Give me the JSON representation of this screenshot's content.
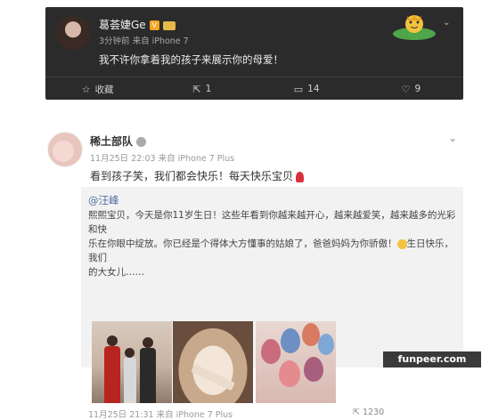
{
  "post1": {
    "user": "葛荟婕Ge",
    "meta": "3分钟前 来自 iPhone 7",
    "text": "我不许你拿着我的孩子来展示你的母爱！",
    "actions": [
      {
        "icon": "star-icon",
        "label": "收藏"
      },
      {
        "icon": "share-icon",
        "label": "1"
      },
      {
        "icon": "comment-icon",
        "label": "14"
      },
      {
        "icon": "like-icon",
        "label": "9"
      }
    ]
  },
  "post2": {
    "user": "稀土部队",
    "meta": "11月25日 22:03 来自 iPhone 7 Plus",
    "text": "看到孩子笑，我们都会快乐！每天快乐宝贝",
    "repost": {
      "user": "@汪峰",
      "text_line1": "熙熙宝贝，今天是你11岁生日！这些年看到你越来越开心，越来越爱笑，越来越多的光彩和快",
      "text_line2": "乐在你眼中绽放。你已经是个得体大方懂事的姑娘了，爸爸妈妈为你骄傲！",
      "text_line2_tail": "生日快乐，我们",
      "text_line3": "的大女儿……",
      "meta": "11月25日 21:31 来自 iPhone 7 Plus",
      "reposts": "1230"
    }
  },
  "watermark": {
    "site": "funpeer.com"
  },
  "colors": {
    "dark_card": "#2b2b2b",
    "link": "#4a6fa5",
    "repost_bg": "#f2f2f2"
  }
}
